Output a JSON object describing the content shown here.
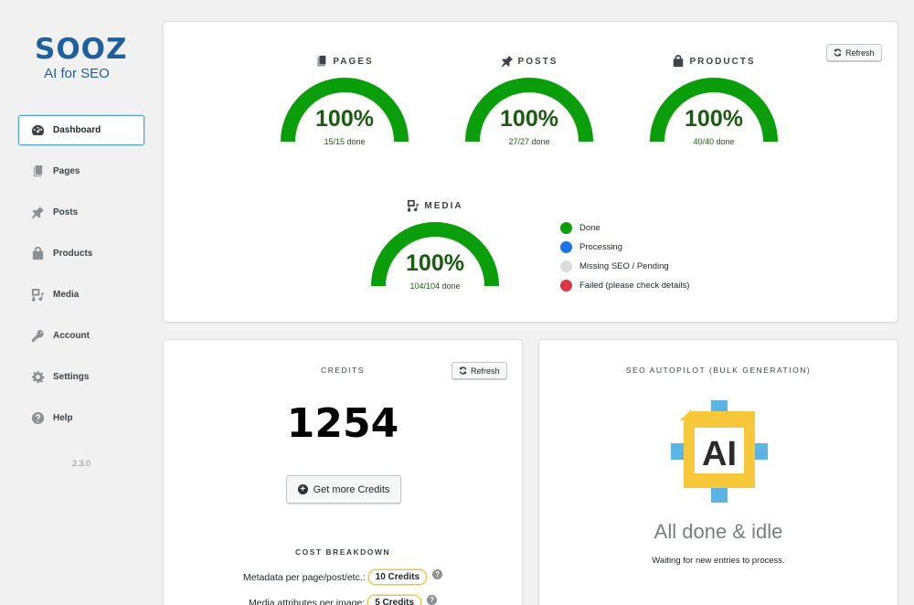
{
  "brand": {
    "logo_text": "SOOZ",
    "tagline": "AI for SEO"
  },
  "sidebar": {
    "items": [
      {
        "label": "Dashboard",
        "icon": "dashboard-icon",
        "active": true
      },
      {
        "label": "Pages",
        "icon": "pages-icon",
        "active": false
      },
      {
        "label": "Posts",
        "icon": "pin-icon",
        "active": false
      },
      {
        "label": "Products",
        "icon": "bag-icon",
        "active": false
      },
      {
        "label": "Media",
        "icon": "media-icon",
        "active": false
      },
      {
        "label": "Account",
        "icon": "key-icon",
        "active": false
      },
      {
        "label": "Settings",
        "icon": "gear-icon",
        "active": false
      },
      {
        "label": "Help",
        "icon": "help-icon",
        "active": false
      }
    ],
    "version": "2.3.0"
  },
  "status": {
    "refresh_label": "Refresh",
    "gauges": [
      {
        "title": "PAGES",
        "icon": "pages-icon",
        "percent": "100%",
        "count": "15/15 done",
        "fraction": 1.0
      },
      {
        "title": "POSTS",
        "icon": "pin-icon",
        "percent": "100%",
        "count": "27/27 done",
        "fraction": 1.0
      },
      {
        "title": "PRODUCTS",
        "icon": "bag-icon",
        "percent": "100%",
        "count": "40/40 done",
        "fraction": 1.0
      },
      {
        "title": "MEDIA",
        "icon": "media-icon",
        "percent": "100%",
        "count": "104/104 done",
        "fraction": 1.0
      }
    ],
    "legend": [
      {
        "label": "Done",
        "color": "#0a9e0a"
      },
      {
        "label": "Processing",
        "color": "#1a73e8"
      },
      {
        "label": "Missing SEO / Pending",
        "color": "#dcdcde"
      },
      {
        "label": "Failed (please check details)",
        "color": "#dc3545"
      }
    ],
    "gauge_color": "#0a9e0a"
  },
  "credits": {
    "title": "CREDITS",
    "refresh_label": "Refresh",
    "value": "1254",
    "get_more_label": "Get more Credits",
    "breakdown_title": "COST BREAKDOWN",
    "rows": [
      {
        "label": "Metadata per page/post/etc.:",
        "cost": "10 Credits"
      },
      {
        "label": "Media attributes per image:",
        "cost": "5 Credits"
      }
    ]
  },
  "autopilot": {
    "title": "SEO AUTOPILOT (BULK GENERATION)",
    "logo_text": "AI",
    "status_title": "All done & idle",
    "status_sub": "Waiting for new entries to process."
  }
}
